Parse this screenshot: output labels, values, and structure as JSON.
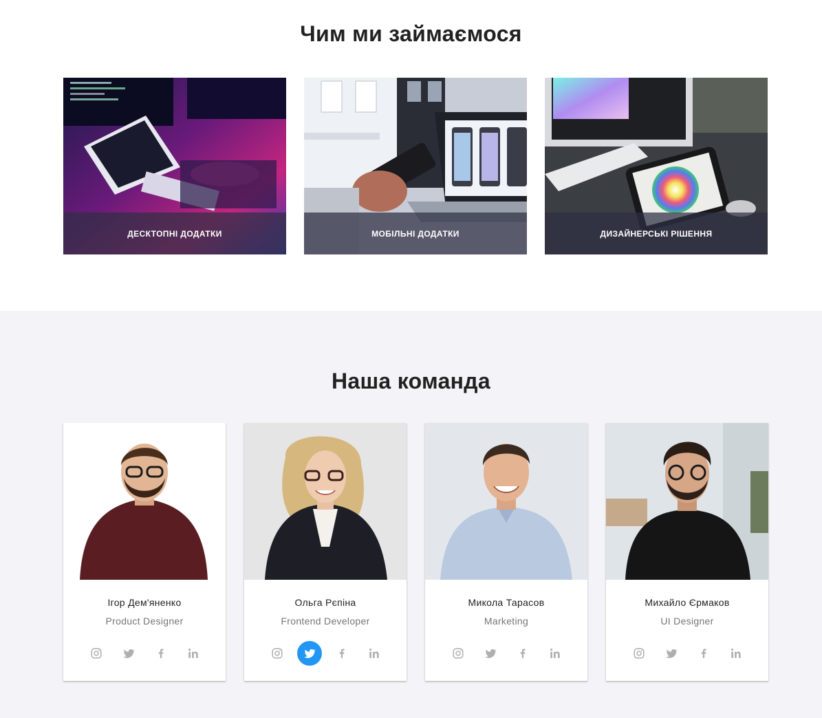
{
  "services": {
    "title": "Чим ми займаємося",
    "items": [
      {
        "caption": "Десктопні додатки"
      },
      {
        "caption": "Мобільні додатки"
      },
      {
        "caption": "Дизайнерські рішення"
      }
    ]
  },
  "team": {
    "title": "Наша команда",
    "members": [
      {
        "name": "Ігор Дем'яненко",
        "role": "Product Designer",
        "active_social": ""
      },
      {
        "name": "Ольга Рєпіна",
        "role": "Frontend Developer",
        "active_social": "twitter"
      },
      {
        "name": "Микола Тарасов",
        "role": "Marketing",
        "active_social": ""
      },
      {
        "name": "Михайло Єрмаков",
        "role": "UI Designer",
        "active_social": ""
      }
    ],
    "socials": [
      "instagram-icon",
      "twitter-icon",
      "facebook-icon",
      "linkedin-icon"
    ]
  },
  "colors": {
    "accent": "#2196f3",
    "icon": "#afafaf",
    "caption_overlay": "#2e2f42",
    "team_bg": "#f4f4f8"
  }
}
